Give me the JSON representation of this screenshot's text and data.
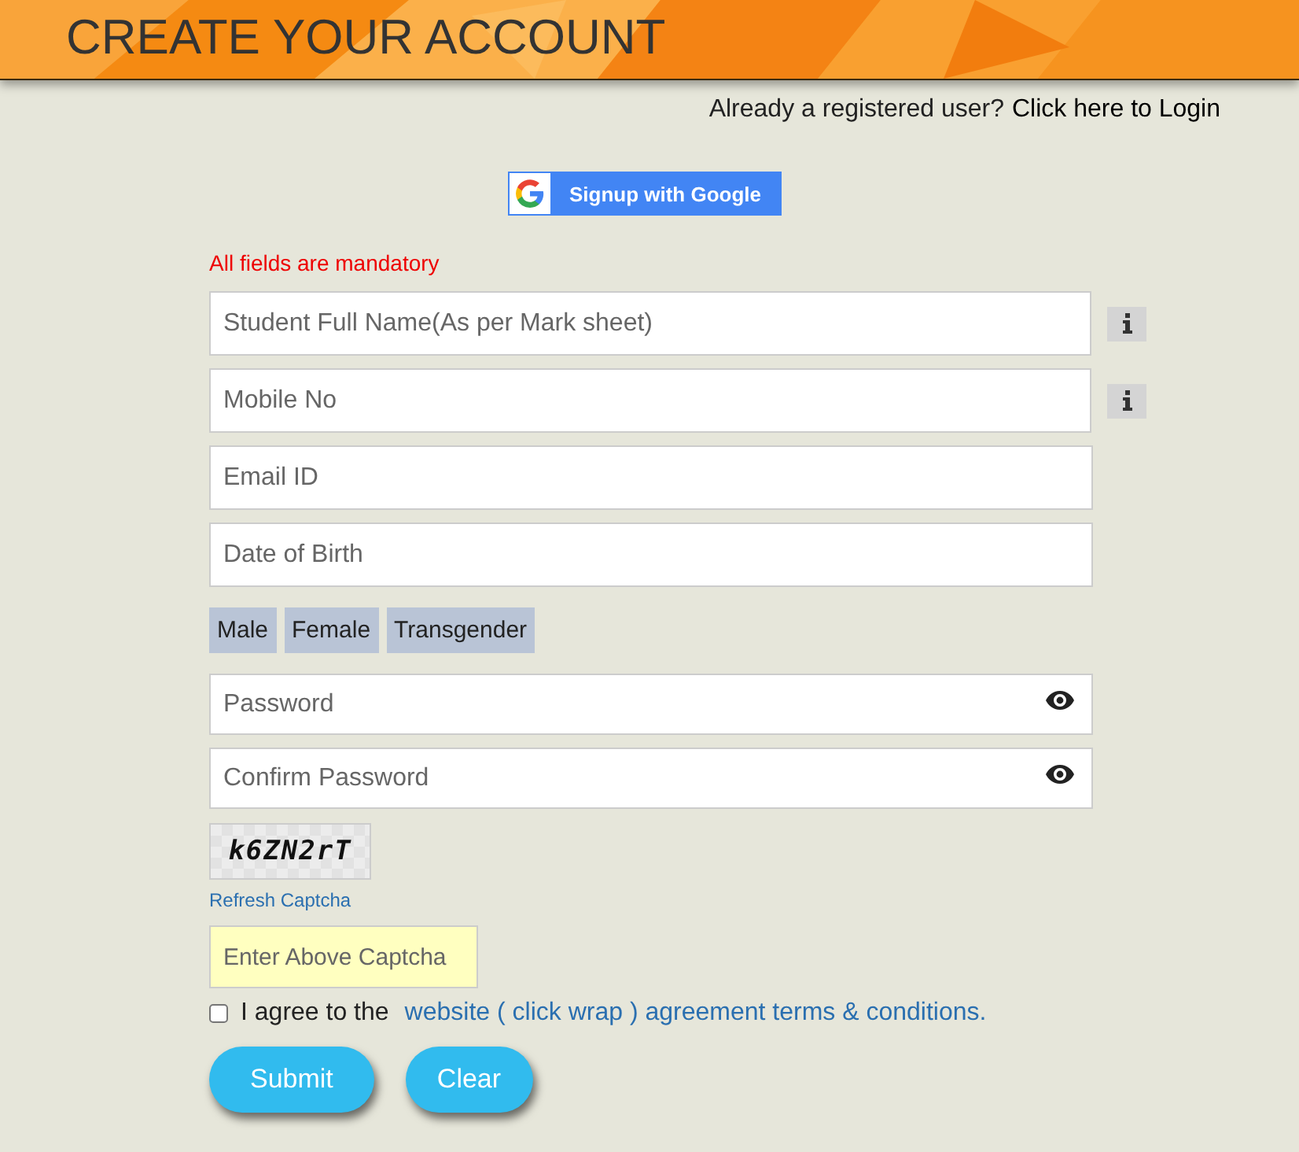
{
  "header": {
    "title": "CREATE YOUR ACCOUNT"
  },
  "login_prompt": {
    "text": "Already a registered user?",
    "link": "Click here to Login"
  },
  "google_button": {
    "label": "Signup with Google"
  },
  "notice": "All fields are mandatory",
  "fields": [
    {
      "placeholder": "Student Full Name(As per Mark sheet)",
      "info": true
    },
    {
      "placeholder": "Mobile No",
      "info": true
    },
    {
      "placeholder": "Email ID",
      "info": false
    },
    {
      "placeholder": "Date of Birth",
      "info": false
    }
  ],
  "genders": [
    {
      "label": "Male",
      "selected": false
    },
    {
      "label": "Female",
      "selected": false
    },
    {
      "label": "Transgender",
      "selected": false
    }
  ],
  "password_fields": [
    {
      "placeholder": "Password"
    },
    {
      "placeholder": "Confirm Password"
    }
  ],
  "captcha": {
    "code": "k6ZN2rT",
    "refresh": "Refresh Captcha",
    "placeholder": "Enter Above Captcha"
  },
  "agreement": {
    "checked": false,
    "text": "I agree to the",
    "link": "website ( click wrap ) agreement terms & conditions."
  },
  "buttons": [
    "Submit",
    "Clear"
  ]
}
